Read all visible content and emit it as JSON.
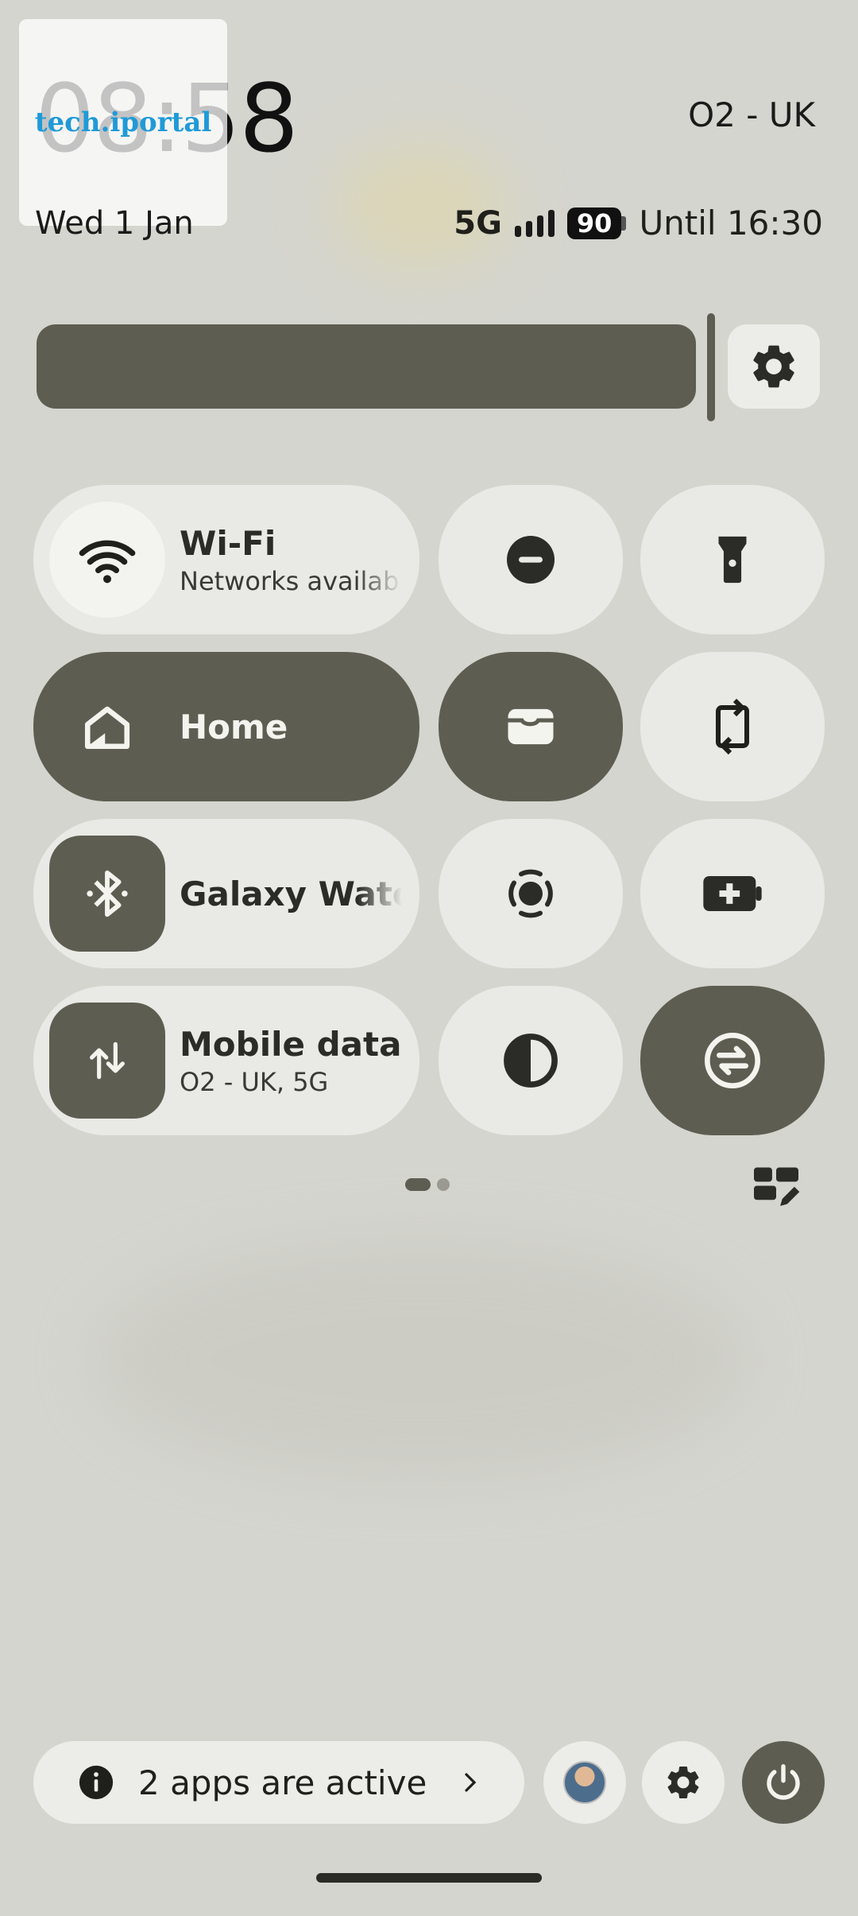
{
  "header": {
    "clock": "08:58",
    "carrier": "O2 - UK",
    "date": "Wed 1 Jan",
    "network": "5G",
    "battery": "90",
    "battery_status": "Until 16:30"
  },
  "watermark": {
    "text": "tech.iportal"
  },
  "tiles": {
    "wifi": {
      "title": "Wi-Fi",
      "subtitle": "Networks available"
    },
    "home": {
      "title": "Home"
    },
    "bluetooth": {
      "title": "Galaxy Watch"
    },
    "mobile_data": {
      "title": "Mobile data",
      "subtitle": "O2 - UK, 5G"
    }
  },
  "footer": {
    "active_apps": "2 apps are active"
  },
  "colors": {
    "dark_tile": "#5d5d52",
    "light_tile": "#e9e9e5",
    "background": "#d5d5cf"
  }
}
